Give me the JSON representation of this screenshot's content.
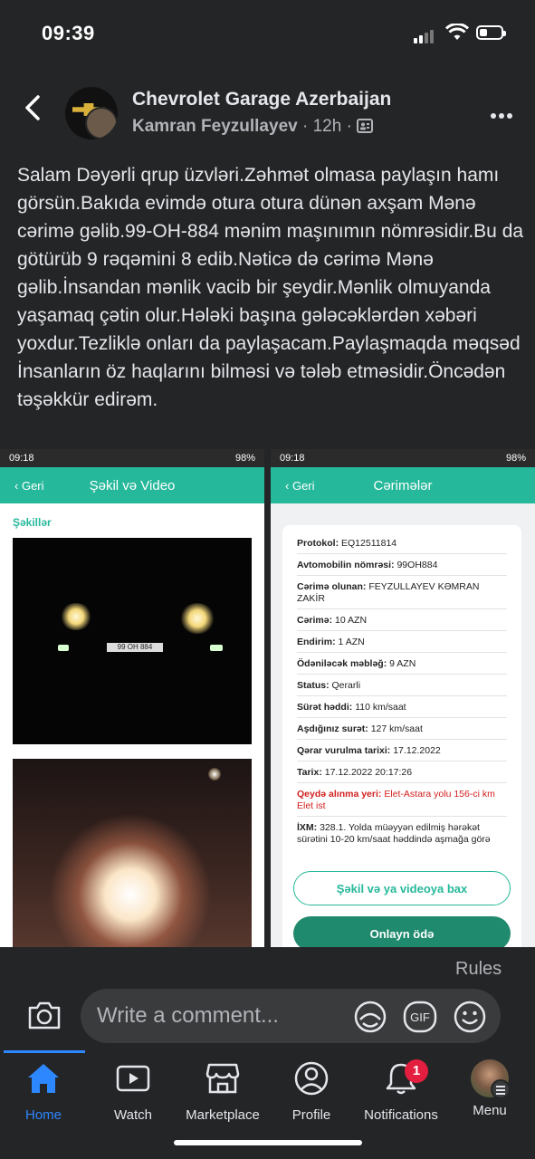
{
  "status_bar": {
    "time": "09:39"
  },
  "header": {
    "group_name": "Chevrolet Garage Azerbaijan",
    "author": "Kamran Feyzullayev",
    "age": "· 12h ·"
  },
  "post": {
    "text": "Salam Dəyərli qrup üzvləri.Zəhmət olmasa paylaşın hamı görsün.Bakıda evimdə otura otura dünən axşam Mənə cərimə gəlib.99-OH-884 mənim maşınımın nömrəsidir.Bu da götürüb 9 rəqəmini 8 edib.Nəticə də cərimə Mənə gəlib.İnsandan mənlik vacib bir şeydir.Mənlik olmuyanda yaşamaq çətin olur.Hələki başına gələcəklərdən xəbəri yoxdur.Tezliklə onları da paylaşacam.Paylaşmaqda məqsəd İnsanların öz haqlarını bilməsi və tələb etməsidir.Öncədən təşəkkür edirəm."
  },
  "left_shot": {
    "time": "09:18",
    "right_status": "98%",
    "back": "Geri",
    "title": "Şəkil və Video",
    "section": "Şəkillər",
    "plate": "99 OH 884"
  },
  "right_shot": {
    "time": "09:18",
    "right_status": "98%",
    "back": "Geri",
    "title": "Cərimələr",
    "rows": [
      {
        "label": "Protokol:",
        "value": "EQ12511814"
      },
      {
        "label": "Avtomobilin nömrəsi:",
        "value": "99OH884"
      },
      {
        "label": "Cərimə olunan:",
        "value": "FEYZULLAYEV KƏMRAN ZAKİR"
      },
      {
        "label": "Cərimə:",
        "value": "10 AZN"
      },
      {
        "label": "Endirim:",
        "value": "1 AZN"
      },
      {
        "label": "Ödəniləcək məbləğ:",
        "value": "9 AZN"
      },
      {
        "label": "Status:",
        "value": "Qerarli"
      },
      {
        "label": "Sürət həddi:",
        "value": "110 km/saat"
      },
      {
        "label": "Aşdığınız surət:",
        "value": "127 km/saat"
      },
      {
        "label": "Qərar vurulma tarixi:",
        "value": "17.12.2022"
      },
      {
        "label": "Tarix:",
        "value": "17.12.2022 20:17:26"
      },
      {
        "label": "Qeydə alınma yeri:",
        "value": "Elet-Astara yolu 156-ci km Elet ist"
      },
      {
        "label": "İXM:",
        "value": "328.1. Yolda müəyyən edilmiş hərəkət sürətini 10-20 km/saat həddində aşmağa görə"
      }
    ],
    "btn_view": "Şəkil və ya videoya bax",
    "btn_pay": "Onlayn ödə"
  },
  "comment": {
    "rules": "Rules",
    "placeholder": "Write a comment..."
  },
  "tabs": [
    {
      "label": "Home",
      "icon": "home-icon"
    },
    {
      "label": "Watch",
      "icon": "watch-icon"
    },
    {
      "label": "Marketplace",
      "icon": "marketplace-icon"
    },
    {
      "label": "Profile",
      "icon": "profile-icon"
    },
    {
      "label": "Notifications",
      "icon": "bell-icon"
    },
    {
      "label": "Menu",
      "icon": "menu-avatar"
    }
  ],
  "notifications_badge": "1",
  "colors": {
    "accent": "#2d88ff",
    "teal": "#26b89a",
    "badge": "#e41e3f",
    "bg": "#242526"
  }
}
